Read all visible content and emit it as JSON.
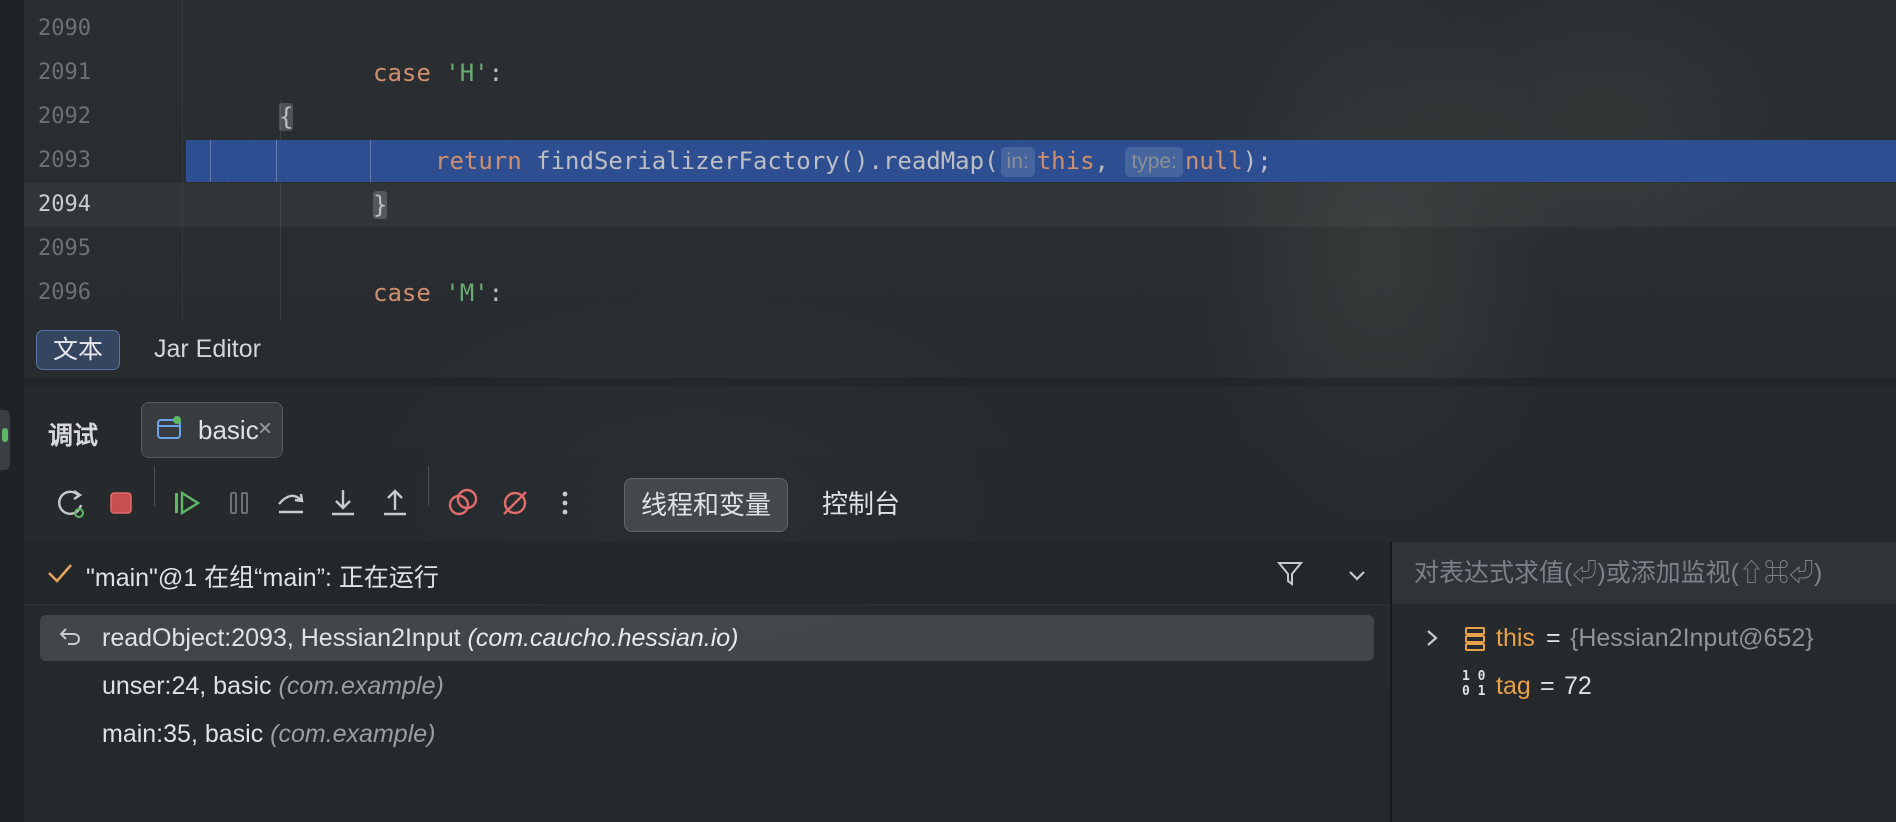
{
  "editor": {
    "lines": [
      {
        "num": "2090",
        "code": ""
      },
      {
        "num": "2091",
        "kw": "case",
        "str": "'H'",
        "tail": ":"
      },
      {
        "num": "2092",
        "brace": "{"
      },
      {
        "num": "2093",
        "kw": "return",
        "call": "findSerializerFactory().readMap(",
        "hint1": "in:",
        "arg1": "this",
        "comma": ",",
        "hint2": "type:",
        "arg2": "null",
        "end": ");"
      },
      {
        "num": "2094",
        "brace": "}"
      },
      {
        "num": "2095",
        "code": ""
      },
      {
        "num": "2096",
        "kw": "case",
        "str": "'M'",
        "tail": ":"
      }
    ]
  },
  "editor_tabs": {
    "text_tab": "文本",
    "jar_editor_tab": "Jar Editor"
  },
  "debug": {
    "title": "调试",
    "session_tab": "basic",
    "session_close": "×",
    "views": {
      "threads_variables": "线程和变量",
      "console": "控制台"
    },
    "thread_status": "\"main\"@1 在组“main”: 正在运行",
    "frames": [
      {
        "method": "readObject:2093, Hessian2Input",
        "package": "(com.caucho.hessian.io)"
      },
      {
        "method": "unser:24, basic",
        "package": "(com.example)"
      },
      {
        "method": "main:35, basic",
        "package": "(com.example)"
      }
    ],
    "eval_placeholder": "对表达式求值(⏎)或添加监视(⇧⌘⏎)",
    "variables": [
      {
        "name": "this",
        "eq": "=",
        "value": "{Hessian2Input@652}"
      },
      {
        "name": "tag",
        "eq": "=",
        "value": "72"
      }
    ]
  },
  "colors": {
    "execution_line": "#2d4f91",
    "keyword": "#cf8e6d",
    "string": "#6aab73",
    "var_name": "#e8a04a"
  },
  "icons": [
    "rerun-icon",
    "stop-icon",
    "resume-icon",
    "pause-icon",
    "step-over-icon",
    "step-into-icon",
    "step-out-icon",
    "view-breakpoints-icon",
    "mute-breakpoints-icon",
    "more-icon",
    "filter-icon",
    "chevron-down-icon",
    "check-icon",
    "return-frame-icon",
    "object-icon",
    "binary-icon",
    "expand-icon",
    "window-icon"
  ]
}
